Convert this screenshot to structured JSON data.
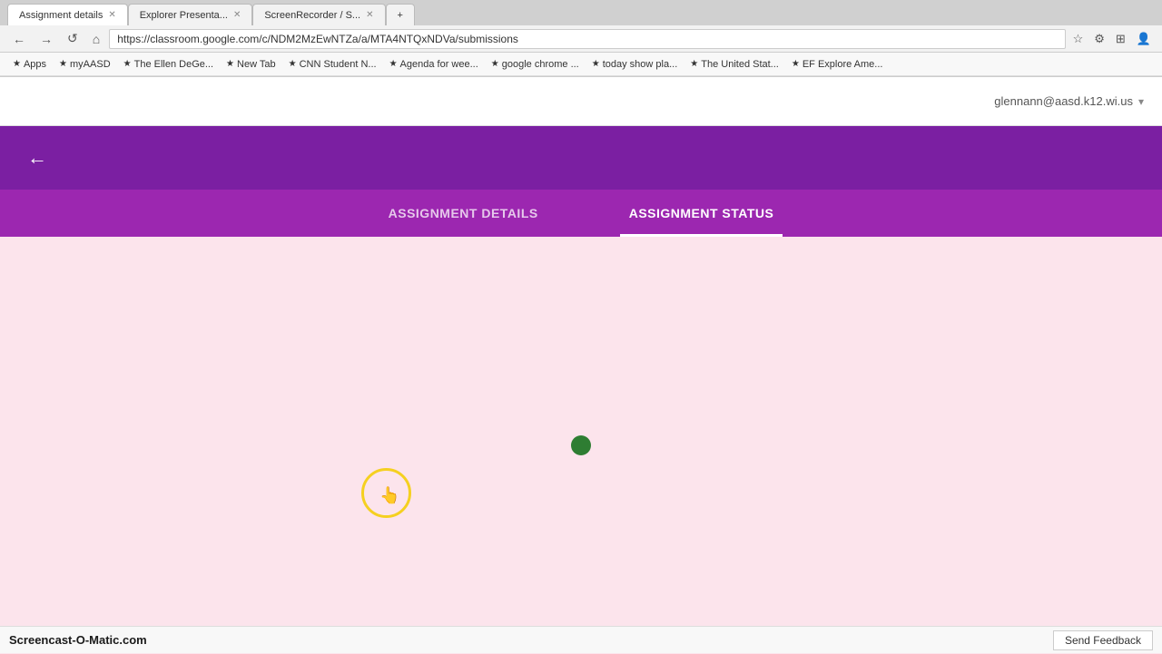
{
  "browser": {
    "tabs": [
      {
        "label": "Assignment details",
        "active": true
      },
      {
        "label": "Explorer Presenta...",
        "active": false
      },
      {
        "label": "ScreenRecorder / S...",
        "active": false
      },
      {
        "label": "",
        "active": false
      }
    ],
    "address": "https://classroom.google.com/c/NDM2MzEwNTZa/a/MTA4NTQxNDVa/submissions",
    "nav_back": "←",
    "nav_forward": "→",
    "nav_refresh": "↺",
    "nav_home": "⌂",
    "icons": {
      "star": "☆",
      "settings": "⚙",
      "extensions": "⊞",
      "person": "👤"
    }
  },
  "bookmarks": [
    {
      "icon": "★",
      "label": "Apps"
    },
    {
      "icon": "★",
      "label": "myAASD"
    },
    {
      "icon": "★",
      "label": "The Ellen DeGe..."
    },
    {
      "icon": "★",
      "label": "New Tab"
    },
    {
      "icon": "★",
      "label": "CNN Student N..."
    },
    {
      "icon": "★",
      "label": "Agenda for wee..."
    },
    {
      "icon": "★",
      "label": "google chrome ..."
    },
    {
      "icon": "★",
      "label": "today show pla..."
    },
    {
      "icon": "★",
      "label": "The United Stat..."
    },
    {
      "icon": "★",
      "label": "EF Explore Ame..."
    }
  ],
  "app": {
    "user_email": "glennann@aasd.k12.wi.us",
    "back_label": "←",
    "tabs": [
      {
        "label": "ASSIGNMENT DETAILS",
        "active": false
      },
      {
        "label": "ASSIGNMENT STATUS",
        "active": true
      }
    ]
  },
  "loading": {
    "visible": true
  },
  "footer": {
    "screencast_label": "Screencast-O-Matic.com",
    "feedback_label": "Send Feedback"
  }
}
